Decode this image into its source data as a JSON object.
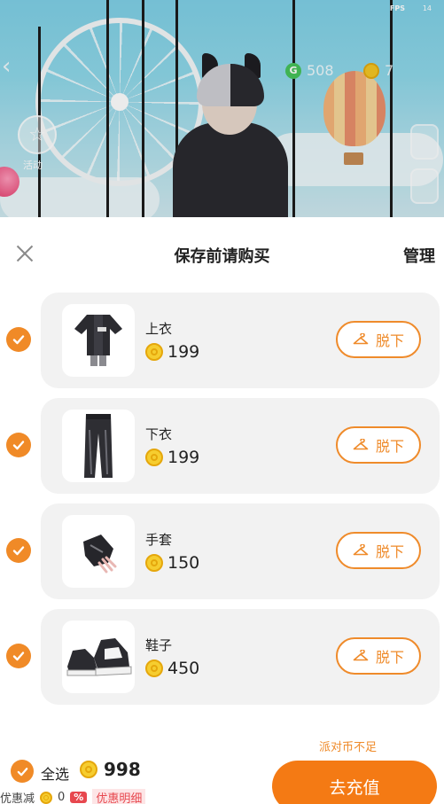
{
  "scene": {
    "fps_label": "FPS",
    "fps_value": "14",
    "g_icon_text": "G",
    "g_currency": "508",
    "gold_currency": "7",
    "side_button_label": "活动"
  },
  "sheet": {
    "title": "保存前请购买",
    "manage_label": "管理",
    "items": [
      {
        "name": "上衣",
        "price": "199",
        "action": "脱下",
        "icon": "top-garment-icon"
      },
      {
        "name": "下衣",
        "price": "199",
        "action": "脱下",
        "icon": "pants-icon"
      },
      {
        "name": "手套",
        "price": "150",
        "action": "脱下",
        "icon": "glove-icon"
      },
      {
        "name": "鞋子",
        "price": "450",
        "action": "脱下",
        "icon": "sneaker-icon"
      }
    ]
  },
  "footer": {
    "insufficient_note": "派对币不足",
    "select_all_label": "全选",
    "total": "998",
    "discount_label": "优惠减",
    "discount_value": "0",
    "discount_badge": "%",
    "discount_detail_link": "优惠明细",
    "recharge_label": "去充值"
  },
  "colors": {
    "accent": "#f08a27",
    "recharge": "#f47a14",
    "coin": "#f6cd2f",
    "discount_red": "#e7474e"
  }
}
